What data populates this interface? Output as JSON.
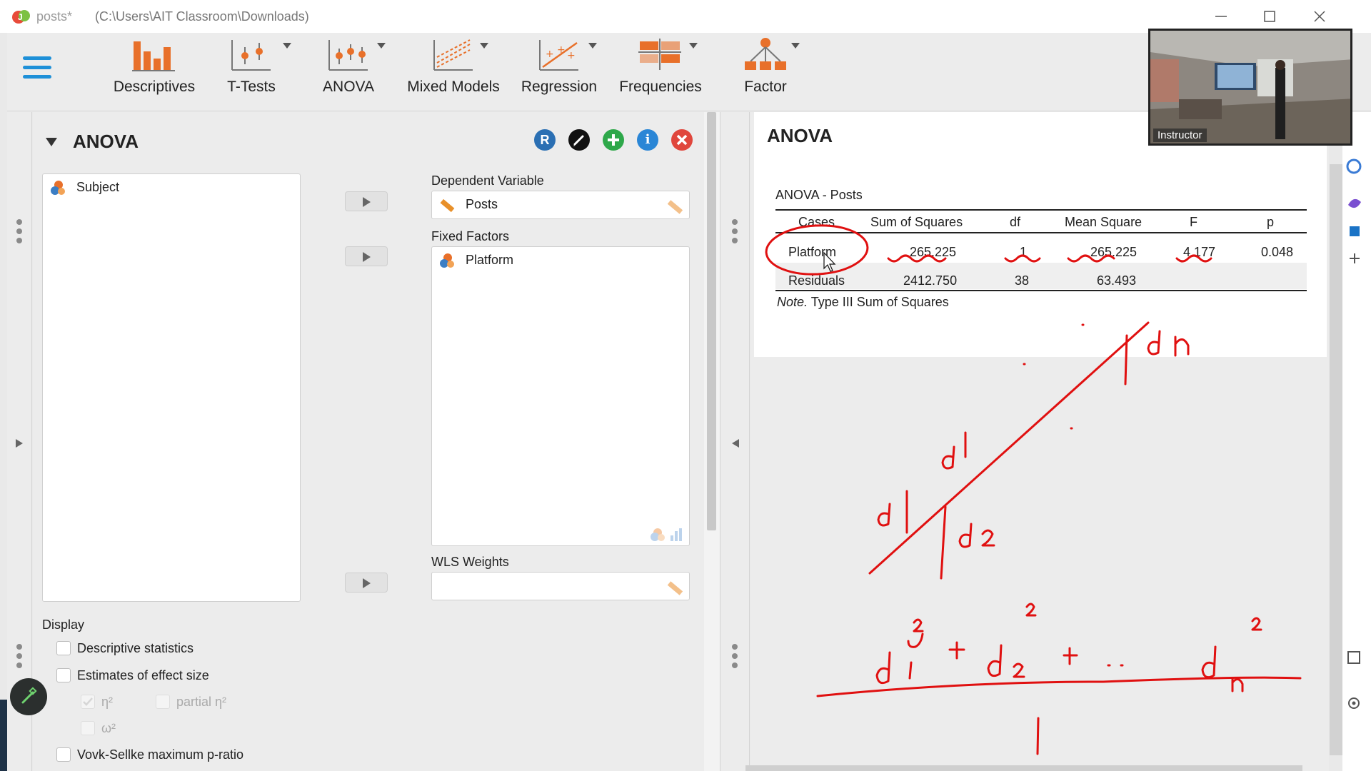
{
  "window": {
    "file_name": "posts*",
    "file_path": "(C:\\Users\\AIT Classroom\\Downloads)"
  },
  "toolbar": {
    "items": [
      {
        "label": "Descriptives"
      },
      {
        "label": "T-Tests"
      },
      {
        "label": "ANOVA"
      },
      {
        "label": "Mixed Models"
      },
      {
        "label": "Regression"
      },
      {
        "label": "Frequencies"
      },
      {
        "label": "Factor"
      }
    ]
  },
  "video": {
    "caption": "Instructor"
  },
  "analysis": {
    "title": "ANOVA",
    "buttons": {
      "r_label": "R",
      "info_label": "i"
    },
    "available_variables": [
      "Subject"
    ],
    "dependent_variable": {
      "label": "Dependent Variable",
      "value": "Posts"
    },
    "fixed_factors": {
      "label": "Fixed Factors",
      "items": [
        "Platform"
      ]
    },
    "wls_weights": {
      "label": "WLS Weights",
      "value": ""
    },
    "display": {
      "label": "Display",
      "options": [
        {
          "label": "Descriptive statistics",
          "checked": false
        },
        {
          "label": "Estimates of effect size",
          "checked": false
        },
        {
          "label": "η²",
          "checked": true,
          "disabled": true
        },
        {
          "label": "partial η²",
          "checked": false,
          "disabled": true
        },
        {
          "label": "ω²",
          "checked": false,
          "disabled": true
        },
        {
          "label": "Vovk-Sellke maximum p-ratio",
          "checked": false
        }
      ]
    }
  },
  "results": {
    "title": "ANOVA",
    "table_title": "ANOVA - Posts",
    "columns": [
      "Cases",
      "Sum of Squares",
      "df",
      "Mean Square",
      "F",
      "p"
    ],
    "rows": [
      {
        "cases": "Platform",
        "ss": "265.225",
        "df": "1",
        "ms": "265.225",
        "f": "4.177",
        "p": "0.048"
      },
      {
        "cases": "Residuals",
        "ss": "2412.750",
        "df": "38",
        "ms": "63.493",
        "f": "",
        "p": ""
      }
    ],
    "note_italic": "Note.",
    "note_text": " Type III Sum of Squares"
  },
  "colors": {
    "accent_blue": "#1e90d8",
    "toolbar_orange": "#e8702a",
    "ink_red": "#e01010",
    "r_button": "#2a6fb3",
    "add_button": "#2ea84a",
    "info_button": "#2a86d6",
    "close_button": "#e0463c"
  }
}
